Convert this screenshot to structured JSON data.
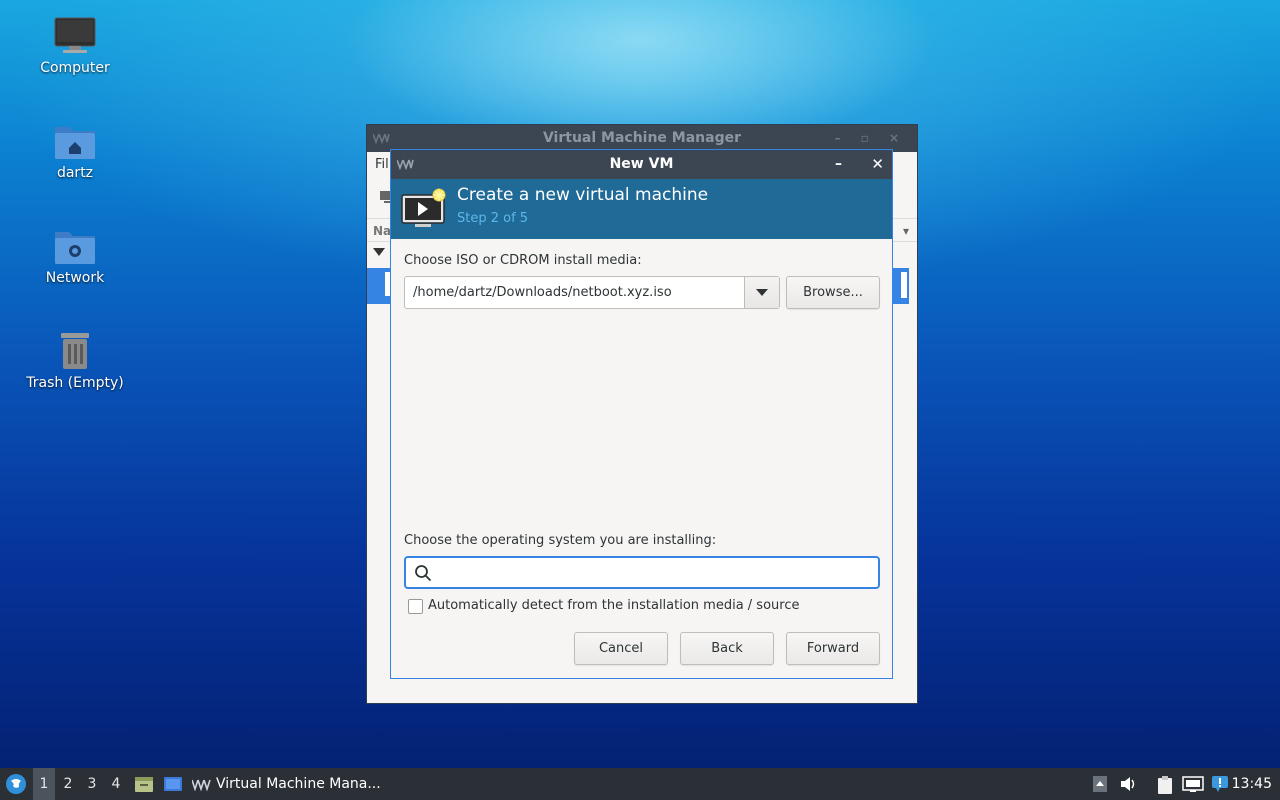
{
  "desktop": {
    "icons": [
      {
        "label": "Computer"
      },
      {
        "label": "dartz"
      },
      {
        "label": "Network"
      },
      {
        "label": "Trash (Empty)"
      }
    ]
  },
  "vmm_window": {
    "title": "Virtual Machine Manager",
    "menu_partial": "Fil",
    "column_partial": "Na"
  },
  "dialog": {
    "title": "New VM",
    "header_title": "Create a new virtual machine",
    "header_step": "Step 2 of 5",
    "iso_label": "Choose ISO or CDROM install media:",
    "iso_value": "/home/dartz/Downloads/netboot.xyz.iso",
    "browse_label": "Browse...",
    "os_label": "Choose the operating system you are installing:",
    "os_search_value": "",
    "autodetect_label": "Automatically detect from the installation media / source",
    "autodetect_checked": false,
    "cancel_label": "Cancel",
    "back_label": "Back",
    "forward_label": "Forward"
  },
  "taskbar": {
    "workspaces": [
      "1",
      "2",
      "3",
      "4"
    ],
    "active_workspace": "1",
    "task_label": "Virtual Machine Mana...",
    "clock": "13:45"
  },
  "colors": {
    "accent": "#3584e4",
    "header_bg": "#1f6a96",
    "titlebar": "#3c4652",
    "taskbar": "#2b3037"
  }
}
